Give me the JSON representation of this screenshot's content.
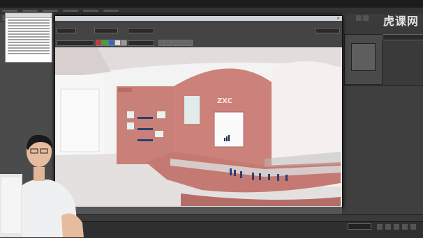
{
  "app": {
    "title": ""
  },
  "menus": [
    "",
    "",
    "",
    "",
    "",
    "",
    "",
    "",
    "",
    "",
    "",
    ""
  ],
  "stats_panel": {
    "title": "",
    "lines": [
      "",
      "",
      "",
      "",
      "",
      "",
      "",
      "",
      "",
      "",
      "",
      "",
      "",
      "",
      "",
      "",
      "",
      "",
      "",
      ""
    ]
  },
  "render_window": {
    "title": "",
    "close_glyph": "×",
    "area_label": "",
    "area_value": "",
    "viewport_label": "",
    "viewport_value": "",
    "preset_label": "",
    "preset_value": "",
    "renderer_label": "",
    "renderer_value": "",
    "channel_value": "",
    "right_select": ""
  },
  "scene": {
    "brand": "ZXC",
    "sub_brand": ""
  },
  "right_panel": {
    "title": "",
    "dropdown": ""
  },
  "watermark": {
    "text": "虎课网"
  },
  "status": {
    "left_text": "",
    "frame": "",
    "time_field": "",
    "right_text": ""
  },
  "colors": {
    "booth_pink": "#c98078",
    "ui_dark": "#3b3b3b",
    "render_bg": "#f2f2f2"
  }
}
